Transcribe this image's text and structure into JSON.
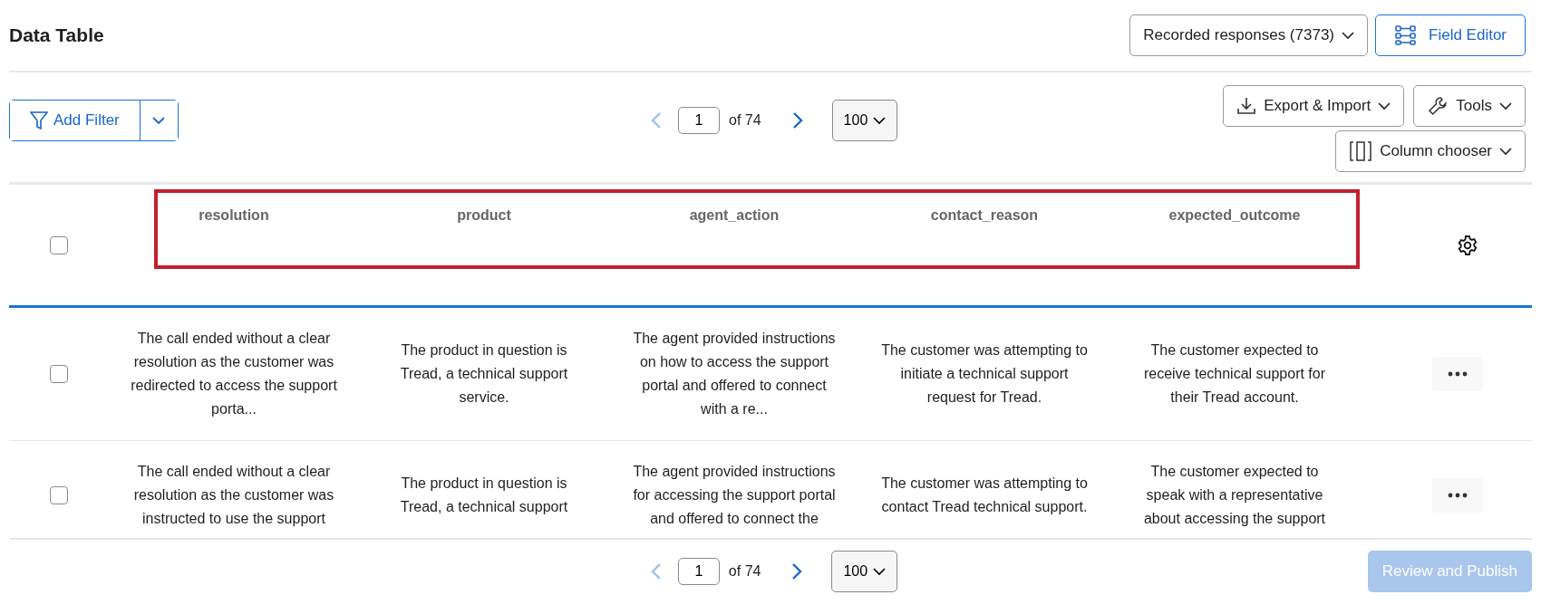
{
  "title": "Data Table",
  "response_filter": {
    "label": "Recorded responses (7373)"
  },
  "field_editor": {
    "label": "Field Editor"
  },
  "add_filter": {
    "label": "Add Filter"
  },
  "pagination_top": {
    "page": "1",
    "of": "of 74",
    "per_page": "100",
    "prev_disabled": true,
    "next_disabled": false
  },
  "toolbar": [
    {
      "label": "Export & Import",
      "kind": "export"
    },
    {
      "label": "Tools",
      "kind": "tools"
    },
    {
      "label": "Column chooser",
      "kind": "columns"
    }
  ],
  "table": {
    "all_selected": false,
    "header_highlighted": true,
    "columns": [
      "resolution",
      "product",
      "agent_action",
      "contact_reason",
      "expected_outcome"
    ],
    "rows": [
      {
        "selected": false,
        "cells": [
          "The call ended without a clear resolution as the customer was redirected to access the support porta...",
          "The product in question is Tread, a technical support service.",
          "The agent provided instructions on how to access the support portal and offered to connect with a re...",
          "The customer was attempting to initiate a technical support request for Tread.",
          "The customer expected to receive technical support for their Tread account."
        ]
      },
      {
        "selected": false,
        "cells": [
          "The call ended without a clear resolution as the customer was instructed to use the support",
          "The product in question is Tread, a technical support",
          "The agent provided instructions for accessing the support portal and offered to connect the",
          "The customer was attempting to contact Tread technical support.",
          "The customer expected to speak with a representative about accessing the support"
        ]
      }
    ]
  },
  "pagination_bottom": {
    "page": "1",
    "of": "of 74",
    "per_page": "100",
    "prev_disabled": true,
    "next_disabled": false
  },
  "publish": {
    "label": "Review and Publish",
    "disabled": true
  }
}
